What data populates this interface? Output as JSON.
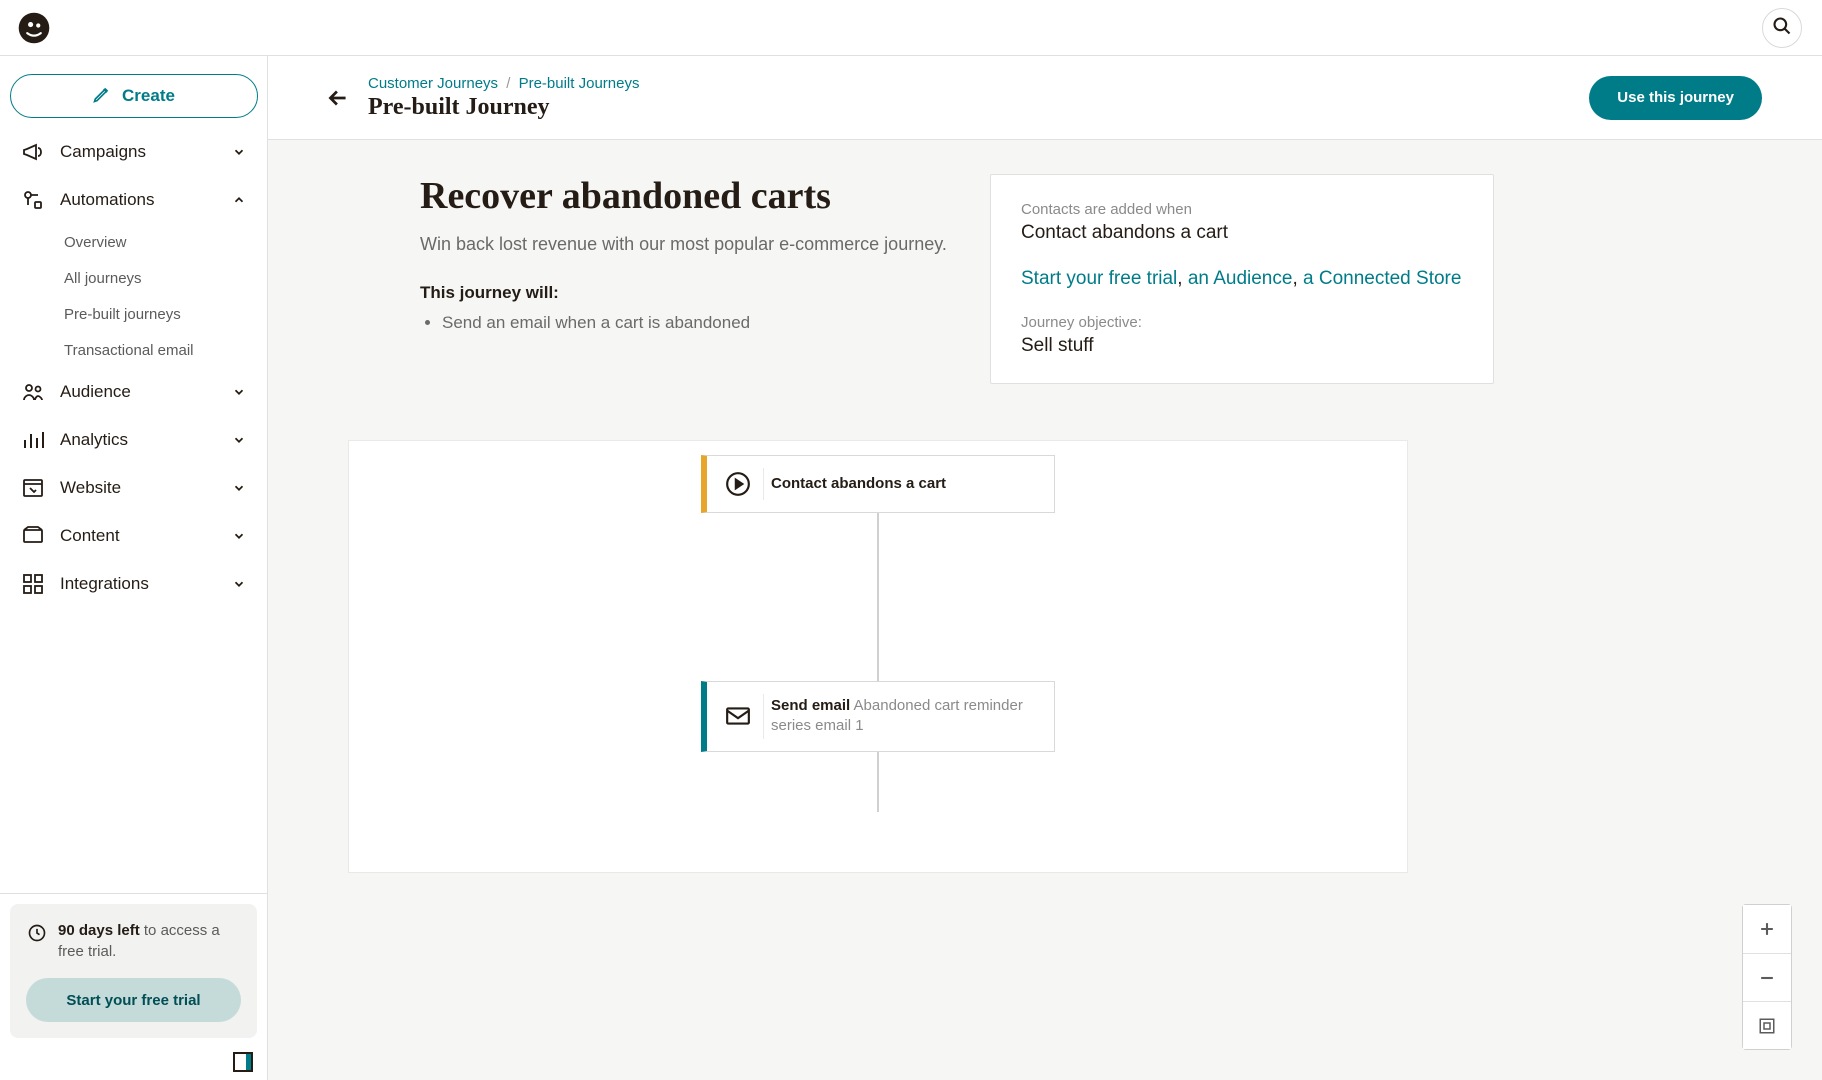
{
  "header": {
    "breadcrumb1": "Customer Journeys",
    "breadcrumb2": "Pre-built Journeys",
    "title": "Pre-built Journey",
    "use_button": "Use this journey"
  },
  "sidebar": {
    "create_label": "Create",
    "items": [
      {
        "label": "Campaigns"
      },
      {
        "label": "Automations",
        "expanded": true,
        "children": [
          {
            "label": "Overview"
          },
          {
            "label": "All journeys"
          },
          {
            "label": "Pre-built journeys"
          },
          {
            "label": "Transactional email"
          }
        ]
      },
      {
        "label": "Audience"
      },
      {
        "label": "Analytics"
      },
      {
        "label": "Website"
      },
      {
        "label": "Content"
      },
      {
        "label": "Integrations"
      }
    ],
    "trial": {
      "bold": "90 days left",
      "rest": " to access a free trial.",
      "cta": "Start your free trial"
    }
  },
  "overview": {
    "title": "Recover abandoned carts",
    "desc": "Win back lost revenue with our most popular e-commerce journey.",
    "subtitle": "This journey will:",
    "bullet1": "Send an email when a cart is abandoned",
    "panel": {
      "added_label": "Contacts are added when",
      "added_value": "Contact abandons a cart",
      "link1": "Start your free trial",
      "link2": "an Audience",
      "link3": "a Connected Store",
      "objective_label": "Journey objective:",
      "objective_value": "Sell stuff"
    }
  },
  "journey": {
    "start_label": "Contact abandons a cart",
    "action_prefix": "Send email",
    "action_rest": " Abandoned cart reminder series email 1"
  }
}
